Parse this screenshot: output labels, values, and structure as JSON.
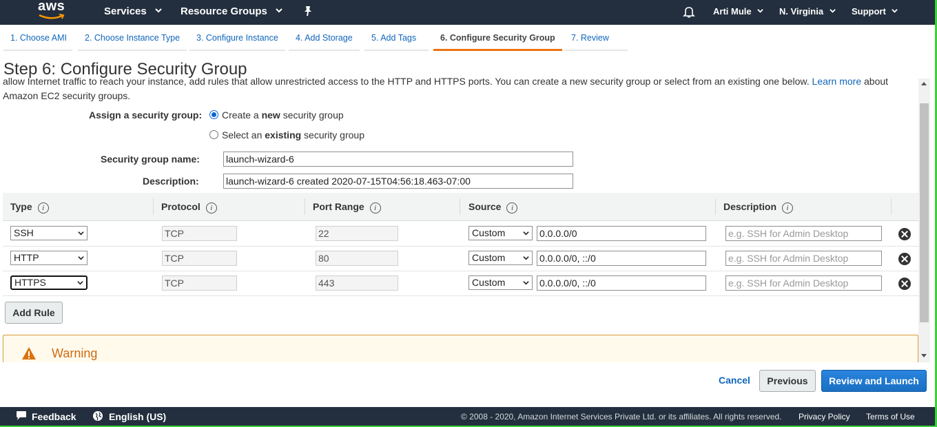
{
  "header": {
    "logo_text": "aws",
    "services": "Services",
    "resource_groups": "Resource Groups",
    "user": "Arti Mule",
    "region": "N. Virginia",
    "support": "Support"
  },
  "wizard_tabs": [
    {
      "label": "1. Choose AMI"
    },
    {
      "label": "2. Choose Instance Type"
    },
    {
      "label": "3. Configure Instance"
    },
    {
      "label": "4. Add Storage"
    },
    {
      "label": "5. Add Tags"
    },
    {
      "label": "6. Configure Security Group",
      "active": true
    },
    {
      "label": "7. Review"
    }
  ],
  "page": {
    "title": "Step 6: Configure Security Group",
    "intro_text": "allow Internet traffic to reach your instance, add rules that allow unrestricted access to the HTTP and HTTPS ports. You can create a new security group or select from an existing one below.",
    "learn_more": "Learn more",
    "intro_suffix": "about",
    "intro_line2": "Amazon EC2 security groups."
  },
  "form": {
    "assign_label": "Assign a security group:",
    "option_new_pre": "Create a ",
    "option_new_bold": "new",
    "option_new_post": " security group",
    "option_existing_pre": "Select an ",
    "option_existing_bold": "existing",
    "option_existing_post": " security group",
    "selected_option": "new",
    "name_label": "Security group name:",
    "name_value": "launch-wizard-6",
    "description_label": "Description:",
    "description_value": "launch-wizard-6 created 2020-07-15T04:56:18.463-07:00"
  },
  "rules_table": {
    "columns": [
      "Type",
      "Protocol",
      "Port Range",
      "Source",
      "Description"
    ],
    "rows": [
      {
        "type": "SSH",
        "protocol": "TCP",
        "port": "22",
        "source_mode": "Custom",
        "source": "0.0.0.0/0",
        "description_placeholder": "e.g. SSH for Admin Desktop"
      },
      {
        "type": "HTTP",
        "protocol": "TCP",
        "port": "80",
        "source_mode": "Custom",
        "source": "0.0.0.0/0, ::/0",
        "description_placeholder": "e.g. SSH for Admin Desktop"
      },
      {
        "type": "HTTPS",
        "protocol": "TCP",
        "port": "443",
        "source_mode": "Custom",
        "source": "0.0.0.0/0, ::/0",
        "description_placeholder": "e.g. SSH for Admin Desktop"
      }
    ],
    "add_rule": "Add Rule"
  },
  "warning": {
    "title": "Warning"
  },
  "actions": {
    "cancel": "Cancel",
    "previous": "Previous",
    "review_launch": "Review and Launch"
  },
  "footer": {
    "feedback": "Feedback",
    "language": "English (US)",
    "copyright": "© 2008 - 2020, Amazon Internet Services Private Ltd. or its affiliates. All rights reserved.",
    "privacy": "Privacy Policy",
    "terms": "Terms of Use"
  },
  "colors": {
    "nav_bg": "#232f3e",
    "accent_orange": "#ec7211",
    "link_blue": "#1166bb",
    "primary_button": "#1a6fc2"
  }
}
